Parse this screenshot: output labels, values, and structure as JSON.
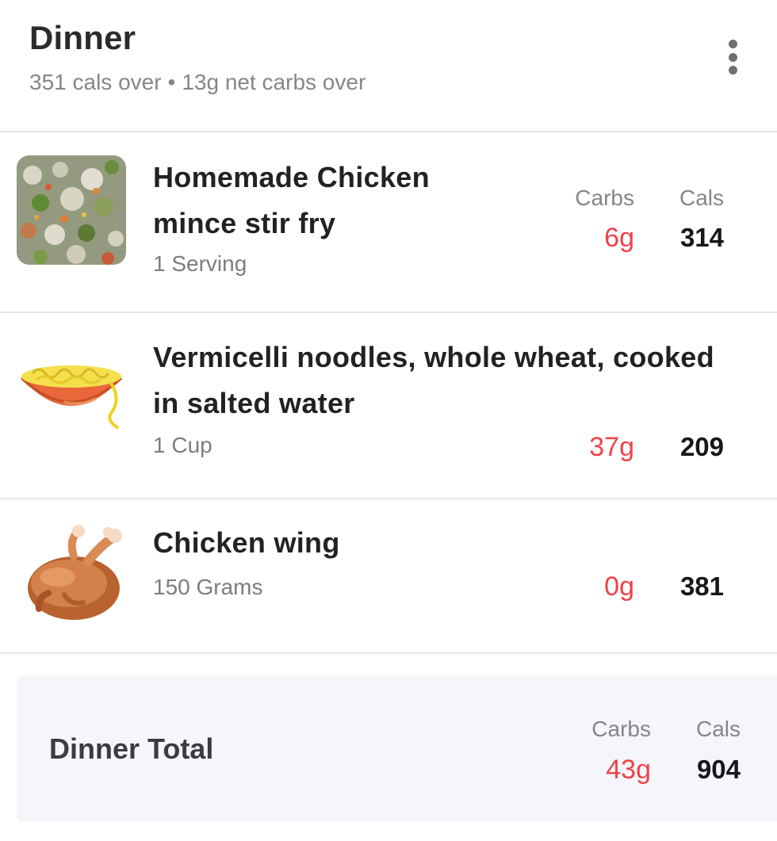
{
  "meal": {
    "title": "Dinner",
    "summary_cals": "351 cals over",
    "summary_separator": "•",
    "summary_carbs": "13g net carbs over",
    "menu_icon": "more-vertical-icon"
  },
  "columns": {
    "carbs": "Carbs",
    "cals": "Cals"
  },
  "foods": [
    {
      "name_line1": "Homemade Chicken",
      "name_line2": "mince stir fry",
      "serving": "1 Serving",
      "carbs": "6g",
      "cals": "314",
      "thumbnail": "stir-fry-photo"
    },
    {
      "name_line1": "Vermicelli noodles, whole wheat, cooked",
      "name_line2": "in salted water",
      "serving": "1 Cup",
      "carbs": "37g",
      "cals": "209",
      "thumbnail": "noodle-bowl-icon"
    },
    {
      "name_line1": "Chicken wing",
      "serving": "150 Grams",
      "carbs": "0g",
      "cals": "381",
      "thumbnail": "roast-chicken-icon"
    }
  ],
  "total": {
    "label": "Dinner Total",
    "carbs": "43g",
    "cals": "904"
  },
  "colors": {
    "carbs_accent": "#f0424a",
    "divider": "#e6e7ea",
    "total_background": "#f5f6f9"
  }
}
